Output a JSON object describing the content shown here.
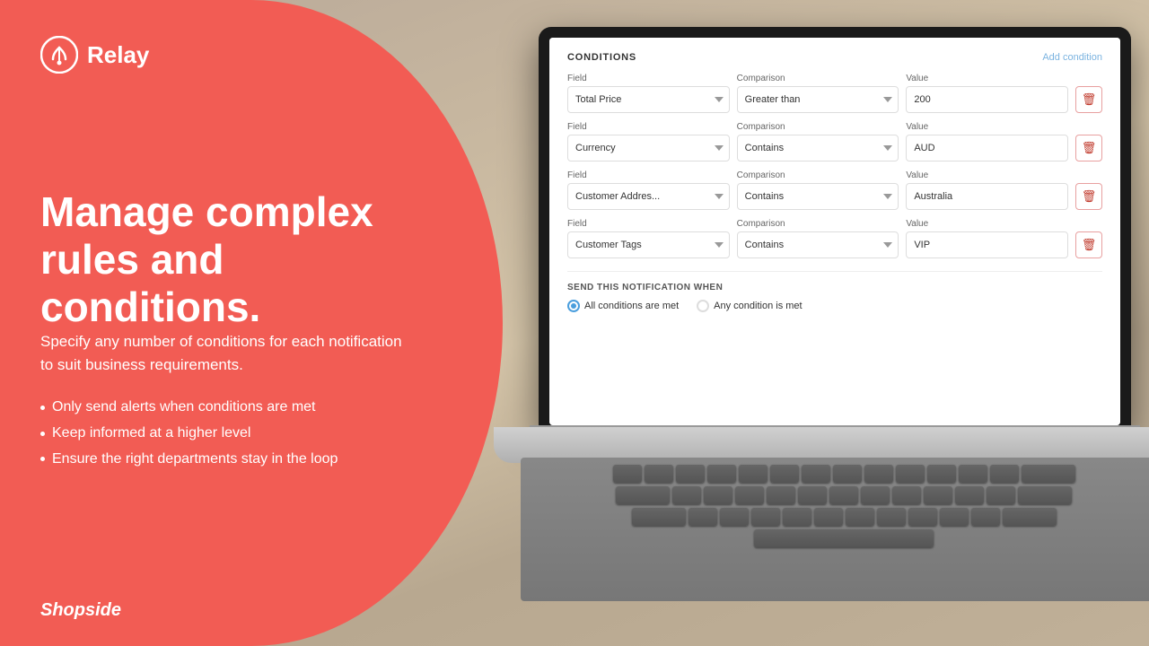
{
  "background": {
    "color": "#c8b89a"
  },
  "logo": {
    "text": "Relay"
  },
  "hero": {
    "heading_line1": "Manage complex",
    "heading_line2": "rules and conditions.",
    "subtext": "Specify any number of conditions for each notification to suit business requirements.",
    "bullets": [
      "Only send alerts when conditions are met",
      "Keep informed at a higher level",
      "Ensure the right departments stay in the loop"
    ]
  },
  "brand": {
    "name": "Shopside"
  },
  "app": {
    "conditions_title": "CONDITIONS",
    "add_condition_label": "Add condition",
    "columns": {
      "field": "Field",
      "comparison": "Comparison",
      "value": "Value"
    },
    "conditions": [
      {
        "field": "Total Price",
        "comparison": "Greater than",
        "value": "200"
      },
      {
        "field": "Currency",
        "comparison": "Contains",
        "value": "AUD"
      },
      {
        "field": "Customer Addres...",
        "comparison": "Contains",
        "value": "Australia"
      },
      {
        "field": "Customer Tags",
        "comparison": "Contains",
        "value": "VIP"
      }
    ],
    "notification_section": {
      "title": "SEND THIS NOTIFICATION WHEN",
      "options": [
        {
          "label": "All conditions are met",
          "selected": true
        },
        {
          "label": "Any condition is met",
          "selected": false
        }
      ]
    }
  }
}
